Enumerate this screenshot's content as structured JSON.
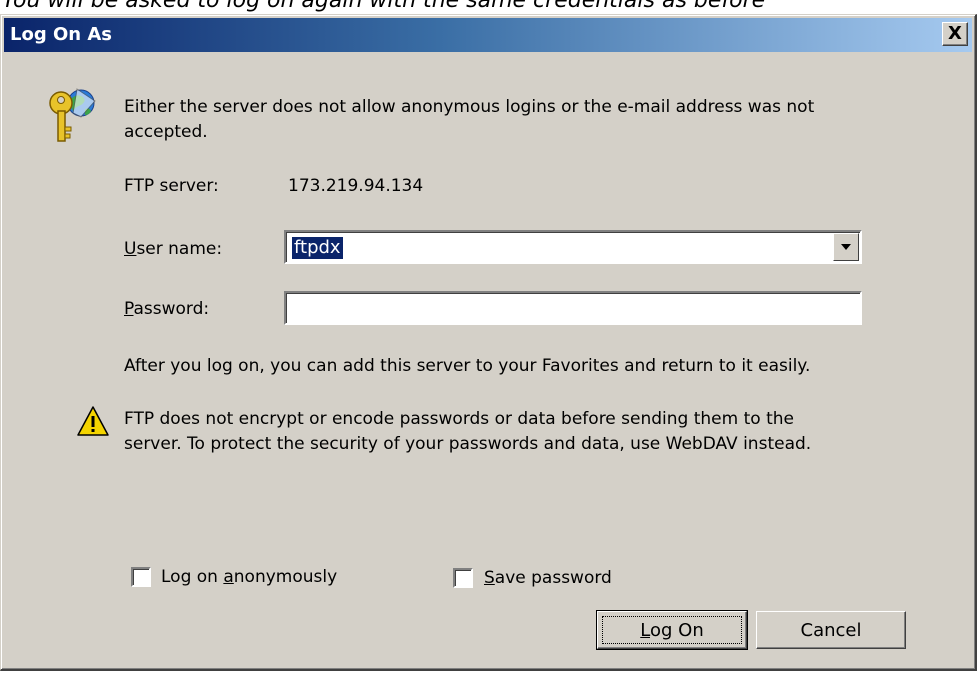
{
  "background_text": "You will be asked to log on again with the same credentials as before",
  "dialog": {
    "title": "Log On As",
    "close_label": "X",
    "message": "Either the server does not allow anonymous logins or the e-mail address was not",
    "message_line2": "accepted.",
    "ftp_server_label": "FTP server:",
    "ftp_server_value": "173.219.94.134",
    "user_name_label_u": "U",
    "user_name_label_rest": "ser name:",
    "user_name_value": "ftpdx",
    "password_label_u": "P",
    "password_label_rest": "assword:",
    "password_value": "",
    "favorites_info": "After you log on, you can add this server to your Favorites and return to it easily.",
    "warning_line1": "FTP does not encrypt or encode passwords or data before sending them to the",
    "warning_line2": "server.  To protect the security of your passwords and data, use WebDAV instead.",
    "anon_label_pre": "Log on ",
    "anon_label_u": "a",
    "anon_label_rest": "nonymously",
    "save_label_u": "S",
    "save_label_rest": "ave password",
    "log_on_button_u": "L",
    "log_on_button_rest": "og On",
    "cancel_button": "Cancel"
  },
  "icons": {
    "keys": "keys-icon",
    "warning": "warning-icon",
    "dropdown": "chevron-down-icon"
  },
  "colors": {
    "titlebar_start": "#0a246a",
    "titlebar_end": "#a6caf0",
    "dialog_bg": "#d4d0c8",
    "selection": "#0a246a"
  }
}
